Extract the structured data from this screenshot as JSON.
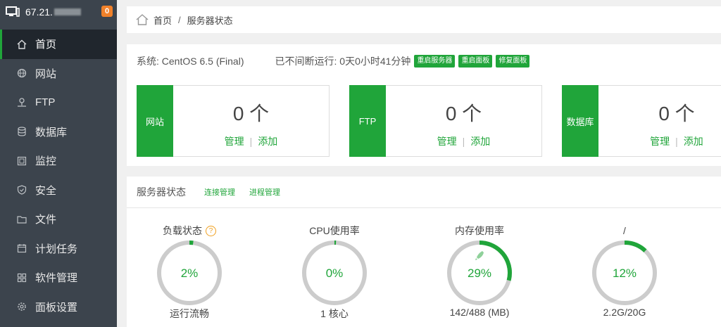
{
  "sidebar": {
    "server_ip": "67.21.",
    "notice_count": "0",
    "items": [
      {
        "label": "首页",
        "icon": "home-icon"
      },
      {
        "label": "网站",
        "icon": "globe-icon"
      },
      {
        "label": "FTP",
        "icon": "ftp-icon"
      },
      {
        "label": "数据库",
        "icon": "database-icon"
      },
      {
        "label": "监控",
        "icon": "monitor-icon"
      },
      {
        "label": "安全",
        "icon": "shield-icon"
      },
      {
        "label": "文件",
        "icon": "folder-icon"
      },
      {
        "label": "计划任务",
        "icon": "calendar-icon"
      },
      {
        "label": "软件管理",
        "icon": "apps-icon"
      },
      {
        "label": "面板设置",
        "icon": "gear-icon"
      }
    ]
  },
  "breadcrumb": {
    "home": "首页",
    "separator": "/",
    "current": "服务器状态"
  },
  "system": {
    "os_label": "系统: CentOS 6.5 (Final)",
    "uptime_label": "已不间断运行: 0天0小时41分钟",
    "buttons": [
      "重启服务器",
      "重启面板",
      "修复面板"
    ]
  },
  "cards": [
    {
      "label": "网站",
      "count": "0 个",
      "manage": "管理",
      "add": "添加"
    },
    {
      "label": "FTP",
      "count": "0 个",
      "manage": "管理",
      "add": "添加"
    },
    {
      "label": "数据库",
      "count": "0 个",
      "manage": "管理",
      "add": "添加"
    }
  ],
  "status": {
    "title": "服务器状态",
    "links": [
      "连接管理",
      "进程管理"
    ],
    "help": "?",
    "gauges": [
      {
        "title": "负载状态",
        "value": "2%",
        "percent": 2,
        "footer": "运行流畅"
      },
      {
        "title": "CPU使用率",
        "value": "0%",
        "percent": 0.8,
        "footer": "1 核心"
      },
      {
        "title": "内存使用率",
        "value": "29%",
        "percent": 29,
        "footer": "142/488 (MB)"
      },
      {
        "title": "/",
        "value": "12%",
        "percent": 12,
        "footer": "2.2G/20G"
      }
    ]
  },
  "colors": {
    "accent": "#20a53a",
    "sidebar": "#3c444d",
    "ring": "#cccccc"
  }
}
